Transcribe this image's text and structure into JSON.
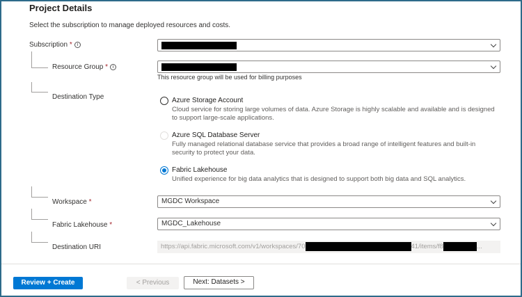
{
  "section": {
    "title": "Project Details",
    "subtitle": "Select the subscription to manage deployed resources and costs."
  },
  "subscription": {
    "label": "Subscription",
    "required": "*",
    "info_icon": "i"
  },
  "resource_group": {
    "label": "Resource Group",
    "required": "*",
    "info_icon": "i",
    "helper": "This resource group will be used for billing purposes"
  },
  "destination_type": {
    "label": "Destination Type",
    "options": [
      {
        "label": "Azure Storage Account",
        "desc": "Cloud service for storing large volumes of data. Azure Storage is highly scalable and available and is designed to support large-scale applications.",
        "state": "unselected"
      },
      {
        "label": "Azure SQL Database Server",
        "desc": "Fully managed relational database service that provides a broad range of intelligent features and built-in security to protect your data.",
        "state": "disabled"
      },
      {
        "label": "Fabric Lakehouse",
        "desc": "Unified experience for big data analytics that is designed to support both big data and SQL analytics.",
        "state": "selected"
      }
    ]
  },
  "workspace": {
    "label": "Workspace",
    "required": "*",
    "value": "MGDC Workspace"
  },
  "lakehouse": {
    "label": "Fabric Lakehouse",
    "required": "*",
    "value": "MGDC_Lakehouse"
  },
  "uri": {
    "label": "Destination URI",
    "prefix": "https://api.fabric.microsoft.com/v1/workspaces/70",
    "middle": "41/items/f8",
    "suffix": "..."
  },
  "footer": {
    "review": "Review + Create",
    "previous": "< Previous",
    "next": "Next: Datasets >"
  },
  "colors": {
    "accent": "#0078d4",
    "frame": "#2e6b8a"
  }
}
